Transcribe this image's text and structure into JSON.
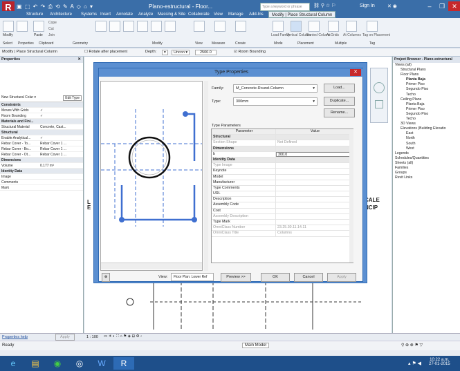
{
  "window": {
    "title": "Plano-estructural - Floor...",
    "search_placeholder": "Type a keyword or phrase",
    "signin": "Sign In",
    "tabs": [
      "Structure",
      "Architecture",
      "Systems",
      "Insert",
      "Annotate",
      "Analyze",
      "Massing & Site",
      "Collaborate",
      "View",
      "Manage",
      "Add-Ins",
      "Modify | Place Structural Column"
    ]
  },
  "ribbon": {
    "modify": "Modify",
    "paste": "Paste",
    "cope": "Cope",
    "cut": "Cut",
    "join": "Join",
    "load_family": "Load Family",
    "vertical_column": "Vertical Column",
    "slanted_column": "Slanted Column",
    "at_grids": "At Grids",
    "at_columns": "At Columns",
    "tag_on_placement": "Tag on Placement",
    "panels": [
      "Select",
      "Properties",
      "Clipboard",
      "Geometry",
      "Modify",
      "View",
      "Measure",
      "Create",
      "Mode",
      "Placement",
      "Multiple",
      "Tag"
    ]
  },
  "optbar": {
    "context": "Modify | Place Structural Column",
    "rotate_after": "Rotate after placement",
    "depth": "Depth:",
    "uncon": "Uncon",
    "depth_value": "2500.0",
    "room_bounding": "Room Bounding"
  },
  "properties": {
    "header": "Properties",
    "type_selector": "New Structural Colur",
    "edit_type": "Edit Type",
    "rows": [
      {
        "k": "Constraints",
        "v": "",
        "group": true
      },
      {
        "k": "Moves With Grids",
        "v": "✓"
      },
      {
        "k": "Room Bounding",
        "v": "✓"
      },
      {
        "k": "Materials and Fini...",
        "v": "",
        "group": true
      },
      {
        "k": "Structural Material",
        "v": "Concrete, Cast..."
      },
      {
        "k": "Structural",
        "v": "",
        "group": true
      },
      {
        "k": "Enable Analytical...",
        "v": "✓"
      },
      {
        "k": "Rebar Cover - To...",
        "v": "Rebar Cover 1 ..."
      },
      {
        "k": "Rebar Cover - Bo...",
        "v": "Rebar Cover 1 ..."
      },
      {
        "k": "Rebar Cover - Ot...",
        "v": "Rebar Cover 1 ..."
      },
      {
        "k": "Dimensions",
        "v": "",
        "group": true
      },
      {
        "k": "Volume",
        "v": "0.177 m³"
      },
      {
        "k": "Identity Data",
        "v": "",
        "group": true
      },
      {
        "k": "Image",
        "v": ""
      },
      {
        "k": "Comments",
        "v": ""
      },
      {
        "k": "Mark",
        "v": ""
      }
    ],
    "help": "Properties help",
    "apply": "Apply"
  },
  "browser": {
    "header": "Project Browser - Plano-estructural",
    "items": [
      {
        "t": "Views (all)",
        "lvl": 0
      },
      {
        "t": "Structural Plans",
        "lvl": 1
      },
      {
        "t": "Floor Plans",
        "lvl": 1
      },
      {
        "t": "Planta Baja",
        "lvl": 2,
        "bold": true
      },
      {
        "t": "Primer Piso",
        "lvl": 2
      },
      {
        "t": "Segundo Piso",
        "lvl": 2
      },
      {
        "t": "Techo",
        "lvl": 2
      },
      {
        "t": "Ceiling Plans",
        "lvl": 1
      },
      {
        "t": "Planta Baja",
        "lvl": 2
      },
      {
        "t": "Primer Piso",
        "lvl": 2
      },
      {
        "t": "Segundo Piso",
        "lvl": 2
      },
      {
        "t": "Techo",
        "lvl": 2
      },
      {
        "t": "3D Views",
        "lvl": 1
      },
      {
        "t": "Elevations (Building Elevatio",
        "lvl": 1
      },
      {
        "t": "East",
        "lvl": 2
      },
      {
        "t": "North",
        "lvl": 2
      },
      {
        "t": "South",
        "lvl": 2
      },
      {
        "t": "West",
        "lvl": 2
      },
      {
        "t": "Legends",
        "lvl": 0
      },
      {
        "t": "Schedules/Quantities",
        "lvl": 0
      },
      {
        "t": "Sheets (all)",
        "lvl": 0
      },
      {
        "t": "Families",
        "lvl": 0
      },
      {
        "t": "Groups",
        "lvl": 0
      },
      {
        "t": "Revit Links",
        "lvl": 0
      }
    ]
  },
  "dialog": {
    "title": "Type Properties",
    "family_label": "Family:",
    "family_value": "M_Concrete-Round-Column",
    "type_label": "Type:",
    "type_value": "300mm",
    "load": "Load...",
    "duplicate": "Duplicate...",
    "rename": "Rename...",
    "type_params": "Type Parameters",
    "col_param": "Parameter",
    "col_value": "Value",
    "rows": [
      {
        "k": "Structural",
        "v": "",
        "group": true
      },
      {
        "k": "Section Shape",
        "v": "Not Defined",
        "dim": true
      },
      {
        "k": "Dimensions",
        "v": "",
        "group": true
      },
      {
        "k": "b",
        "v": "300.0"
      },
      {
        "k": "Identity Data",
        "v": "",
        "group": true
      },
      {
        "k": "Type Image",
        "v": "",
        "dim": true
      },
      {
        "k": "Keynote",
        "v": ""
      },
      {
        "k": "Model",
        "v": ""
      },
      {
        "k": "Manufacturer",
        "v": ""
      },
      {
        "k": "Type Comments",
        "v": ""
      },
      {
        "k": "URL",
        "v": ""
      },
      {
        "k": "Description",
        "v": ""
      },
      {
        "k": "Assembly Code",
        "v": ""
      },
      {
        "k": "Cost",
        "v": ""
      },
      {
        "k": "Assembly Description",
        "v": "",
        "dim": true
      },
      {
        "k": "Type Mark",
        "v": ""
      },
      {
        "k": "OmniClass Number",
        "v": "23.25.30.11.14.11",
        "dim": true
      },
      {
        "k": "OmniClass Title",
        "v": "Columns",
        "dim": true
      }
    ],
    "view_label": "View:",
    "view_value": "Floor Plan: Lower Ref",
    "preview_btn": "Preview >>",
    "ok": "OK",
    "cancel": "Cancel",
    "apply": "Apply"
  },
  "view_control": {
    "scale": "1 : 100"
  },
  "status": {
    "ready": "Ready",
    "model": "Main Model",
    "partial_text1": "CALE",
    "partial_text2": "NCIP",
    "partial_l": "L",
    "partial_e": "E"
  },
  "taskbar": {
    "time": "10:22 a.m.",
    "date": "27-01-2015"
  },
  "colors": {
    "accent": "#3a6ea8",
    "dialog_frame": "#5b8fd1",
    "close": "#c7282b",
    "preview_blue": "#3f6fd0"
  }
}
